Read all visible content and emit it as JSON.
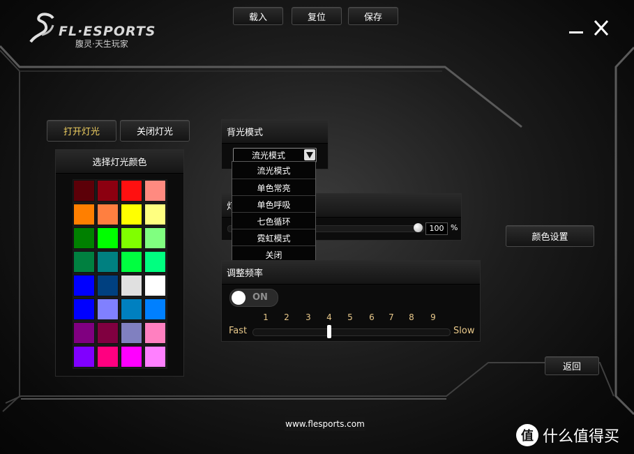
{
  "header": {
    "brand": "FL·ESPORTS",
    "slogan": "腹灵·天生玩家",
    "load_label": "载入",
    "reset_label": "复位",
    "save_label": "保存"
  },
  "light_buttons": {
    "on_label": "打开灯光",
    "off_label": "关闭灯光"
  },
  "color_panel": {
    "title": "选择灯光颜色",
    "swatches": [
      "#5c0008",
      "#8c0010",
      "#ff1010",
      "#ff8a80",
      "#ff7f00",
      "#ff7f40",
      "#ffff00",
      "#ffff80",
      "#008000",
      "#00ff00",
      "#80ff00",
      "#80ff80",
      "#008040",
      "#008080",
      "#00ff40",
      "#00ff80",
      "#0000ff",
      "#004080",
      "#e0e0e0",
      "#ffffff",
      "#0000ff",
      "#8080ff",
      "#0080c0",
      "#0080ff",
      "#800080",
      "#800040",
      "#8080c0",
      "#ff80c0",
      "#8000ff",
      "#ff0080",
      "#ff00ff",
      "#ff80ff"
    ]
  },
  "backlight_panel": {
    "title": "背光模式",
    "selected": "流光模式",
    "options": [
      "流光模式",
      "单色常亮",
      "单色呼吸",
      "七色循环",
      "霓虹模式",
      "关闭"
    ]
  },
  "brightness_panel": {
    "title_partial": "灯",
    "value": "100",
    "unit": "%",
    "level": 1.0
  },
  "frequency_panel": {
    "title": "调整频率",
    "toggle_label": "ON",
    "fast_label": "Fast",
    "slow_label": "Slow",
    "ticks": [
      "1",
      "2",
      "3",
      "4",
      "5",
      "6",
      "7",
      "8",
      "9"
    ],
    "selected_tick": 4
  },
  "color_settings_label": "颜色设置",
  "back_label": "返回",
  "footer": {
    "url": "www.flesports.com"
  },
  "watermark": "值 什么值得买",
  "colors": {
    "accent_yellow": "#f0d060",
    "tick_color": "#e8c88a"
  }
}
